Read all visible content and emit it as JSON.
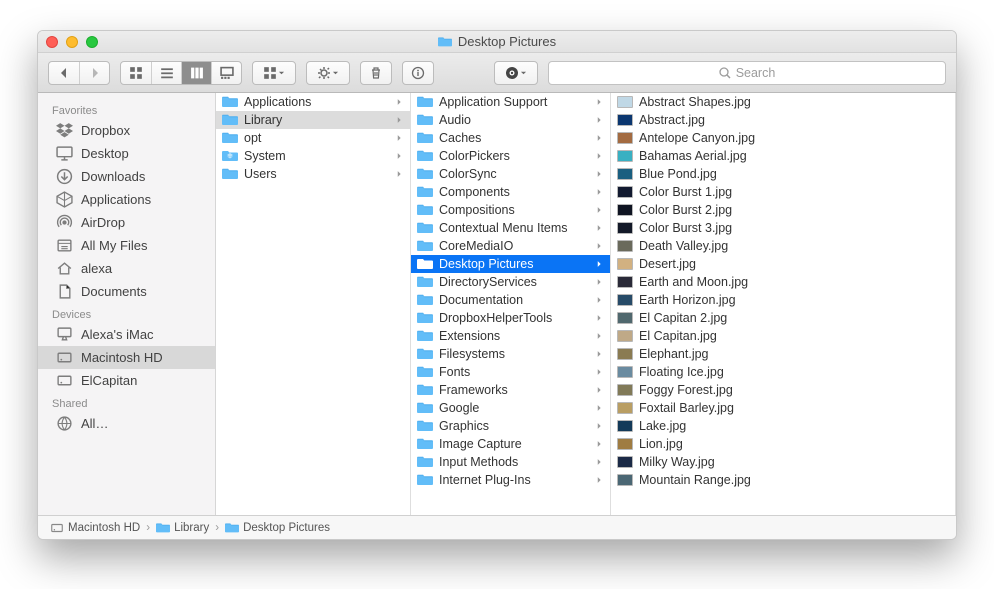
{
  "window": {
    "title": "Desktop Pictures"
  },
  "search": {
    "placeholder": "Search"
  },
  "sidebar": {
    "sections": [
      {
        "header": "Favorites",
        "items": [
          {
            "icon": "dropbox",
            "label": "Dropbox"
          },
          {
            "icon": "desktop",
            "label": "Desktop"
          },
          {
            "icon": "downloads",
            "label": "Downloads"
          },
          {
            "icon": "applications",
            "label": "Applications"
          },
          {
            "icon": "airdrop",
            "label": "AirDrop"
          },
          {
            "icon": "allfiles",
            "label": "All My Files"
          },
          {
            "icon": "home",
            "label": "alexa"
          },
          {
            "icon": "documents",
            "label": "Documents"
          }
        ]
      },
      {
        "header": "Devices",
        "items": [
          {
            "icon": "imac",
            "label": "Alexa's iMac"
          },
          {
            "icon": "hd",
            "label": "Macintosh HD",
            "selected": true
          },
          {
            "icon": "hd",
            "label": "ElCapitan"
          }
        ]
      },
      {
        "header": "Shared",
        "items": [
          {
            "icon": "globe",
            "label": "All…"
          }
        ]
      }
    ]
  },
  "columns": [
    {
      "items": [
        {
          "icon": "folder",
          "label": "Applications",
          "arrow": true
        },
        {
          "icon": "folder",
          "label": "Library",
          "arrow": true,
          "selected": true
        },
        {
          "icon": "folder",
          "label": "opt",
          "arrow": true
        },
        {
          "icon": "folder-sys",
          "label": "System",
          "arrow": true
        },
        {
          "icon": "folder",
          "label": "Users",
          "arrow": true
        }
      ]
    },
    {
      "items": [
        {
          "icon": "folder",
          "label": "Application Support",
          "arrow": true
        },
        {
          "icon": "folder",
          "label": "Audio",
          "arrow": true
        },
        {
          "icon": "folder",
          "label": "Caches",
          "arrow": true
        },
        {
          "icon": "folder",
          "label": "ColorPickers",
          "arrow": true
        },
        {
          "icon": "folder",
          "label": "ColorSync",
          "arrow": true
        },
        {
          "icon": "folder",
          "label": "Components",
          "arrow": true
        },
        {
          "icon": "folder",
          "label": "Compositions",
          "arrow": true
        },
        {
          "icon": "folder",
          "label": "Contextual Menu Items",
          "arrow": true
        },
        {
          "icon": "folder",
          "label": "CoreMediaIO",
          "arrow": true
        },
        {
          "icon": "folder",
          "label": "Desktop Pictures",
          "arrow": true,
          "highlight": true
        },
        {
          "icon": "folder",
          "label": "DirectoryServices",
          "arrow": true
        },
        {
          "icon": "folder",
          "label": "Documentation",
          "arrow": true
        },
        {
          "icon": "folder",
          "label": "DropboxHelperTools",
          "arrow": true
        },
        {
          "icon": "folder",
          "label": "Extensions",
          "arrow": true
        },
        {
          "icon": "folder",
          "label": "Filesystems",
          "arrow": true
        },
        {
          "icon": "folder",
          "label": "Fonts",
          "arrow": true
        },
        {
          "icon": "folder",
          "label": "Frameworks",
          "arrow": true
        },
        {
          "icon": "folder",
          "label": "Google",
          "arrow": true
        },
        {
          "icon": "folder",
          "label": "Graphics",
          "arrow": true
        },
        {
          "icon": "folder",
          "label": "Image Capture",
          "arrow": true
        },
        {
          "icon": "folder",
          "label": "Input Methods",
          "arrow": true
        },
        {
          "icon": "folder",
          "label": "Internet Plug-Ins",
          "arrow": true
        }
      ]
    },
    {
      "items": [
        {
          "thumb": "#c0d8e6",
          "label": "Abstract Shapes.jpg"
        },
        {
          "thumb": "#0b3770",
          "label": "Abstract.jpg"
        },
        {
          "thumb": "#a36b41",
          "label": "Antelope Canyon.jpg"
        },
        {
          "thumb": "#39b0c2",
          "label": "Bahamas Aerial.jpg"
        },
        {
          "thumb": "#1a5f80",
          "label": "Blue Pond.jpg"
        },
        {
          "thumb": "#121a30",
          "label": "Color Burst 1.jpg"
        },
        {
          "thumb": "#0f1422",
          "label": "Color Burst 2.jpg"
        },
        {
          "thumb": "#131928",
          "label": "Color Burst 3.jpg"
        },
        {
          "thumb": "#6a6a5c",
          "label": "Death Valley.jpg"
        },
        {
          "thumb": "#d2b181",
          "label": "Desert.jpg"
        },
        {
          "thumb": "#2a2a38",
          "label": "Earth and Moon.jpg"
        },
        {
          "thumb": "#274b68",
          "label": "Earth Horizon.jpg"
        },
        {
          "thumb": "#50686e",
          "label": "El Capitan 2.jpg"
        },
        {
          "thumb": "#bfa987",
          "label": "El Capitan.jpg"
        },
        {
          "thumb": "#8a7b52",
          "label": "Elephant.jpg"
        },
        {
          "thumb": "#6a8ba0",
          "label": "Floating Ice.jpg"
        },
        {
          "thumb": "#817a58",
          "label": "Foggy Forest.jpg"
        },
        {
          "thumb": "#b99e63",
          "label": "Foxtail Barley.jpg"
        },
        {
          "thumb": "#133a59",
          "label": "Lake.jpg"
        },
        {
          "thumb": "#9f7c42",
          "label": "Lion.jpg"
        },
        {
          "thumb": "#1b2a46",
          "label": "Milky Way.jpg"
        },
        {
          "thumb": "#4b6774",
          "label": "Mountain Range.jpg"
        }
      ]
    }
  ],
  "pathbar": [
    {
      "icon": "hd",
      "label": "Macintosh HD"
    },
    {
      "icon": "folder",
      "label": "Library"
    },
    {
      "icon": "folder",
      "label": "Desktop Pictures"
    }
  ]
}
